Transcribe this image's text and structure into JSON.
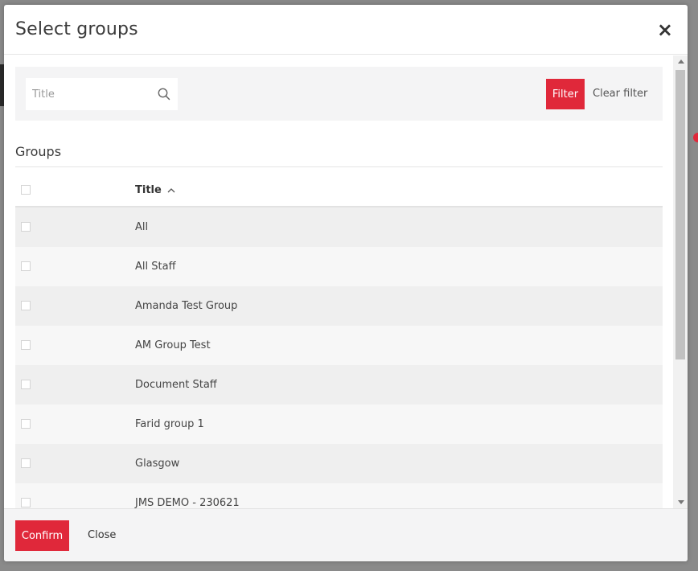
{
  "modal": {
    "title": "Select groups",
    "close_symbol": "×"
  },
  "filter": {
    "search_placeholder": "Title",
    "search_value": "",
    "filter_label": "Filter",
    "clear_label": "Clear filter"
  },
  "groups": {
    "section_title": "Groups",
    "column_title": "Title",
    "sort_direction": "ascending",
    "rows": [
      {
        "title": "All",
        "checked": false
      },
      {
        "title": "All Staff",
        "checked": false
      },
      {
        "title": "Amanda Test Group",
        "checked": false
      },
      {
        "title": "AM Group Test",
        "checked": false
      },
      {
        "title": "Document Staff",
        "checked": false
      },
      {
        "title": "Farid group 1",
        "checked": false
      },
      {
        "title": "Glasgow",
        "checked": false
      },
      {
        "title": "JMS DEMO - 230621",
        "checked": false
      }
    ]
  },
  "footer": {
    "confirm_label": "Confirm",
    "close_label": "Close"
  },
  "colors": {
    "accent": "#e0283a",
    "row_alt": "#efefef",
    "row_plain": "#f7f7f7",
    "panel": "#f4f4f5"
  },
  "icons": {
    "search": "search-icon",
    "sort": "chevron-up-icon",
    "close": "close-icon"
  }
}
